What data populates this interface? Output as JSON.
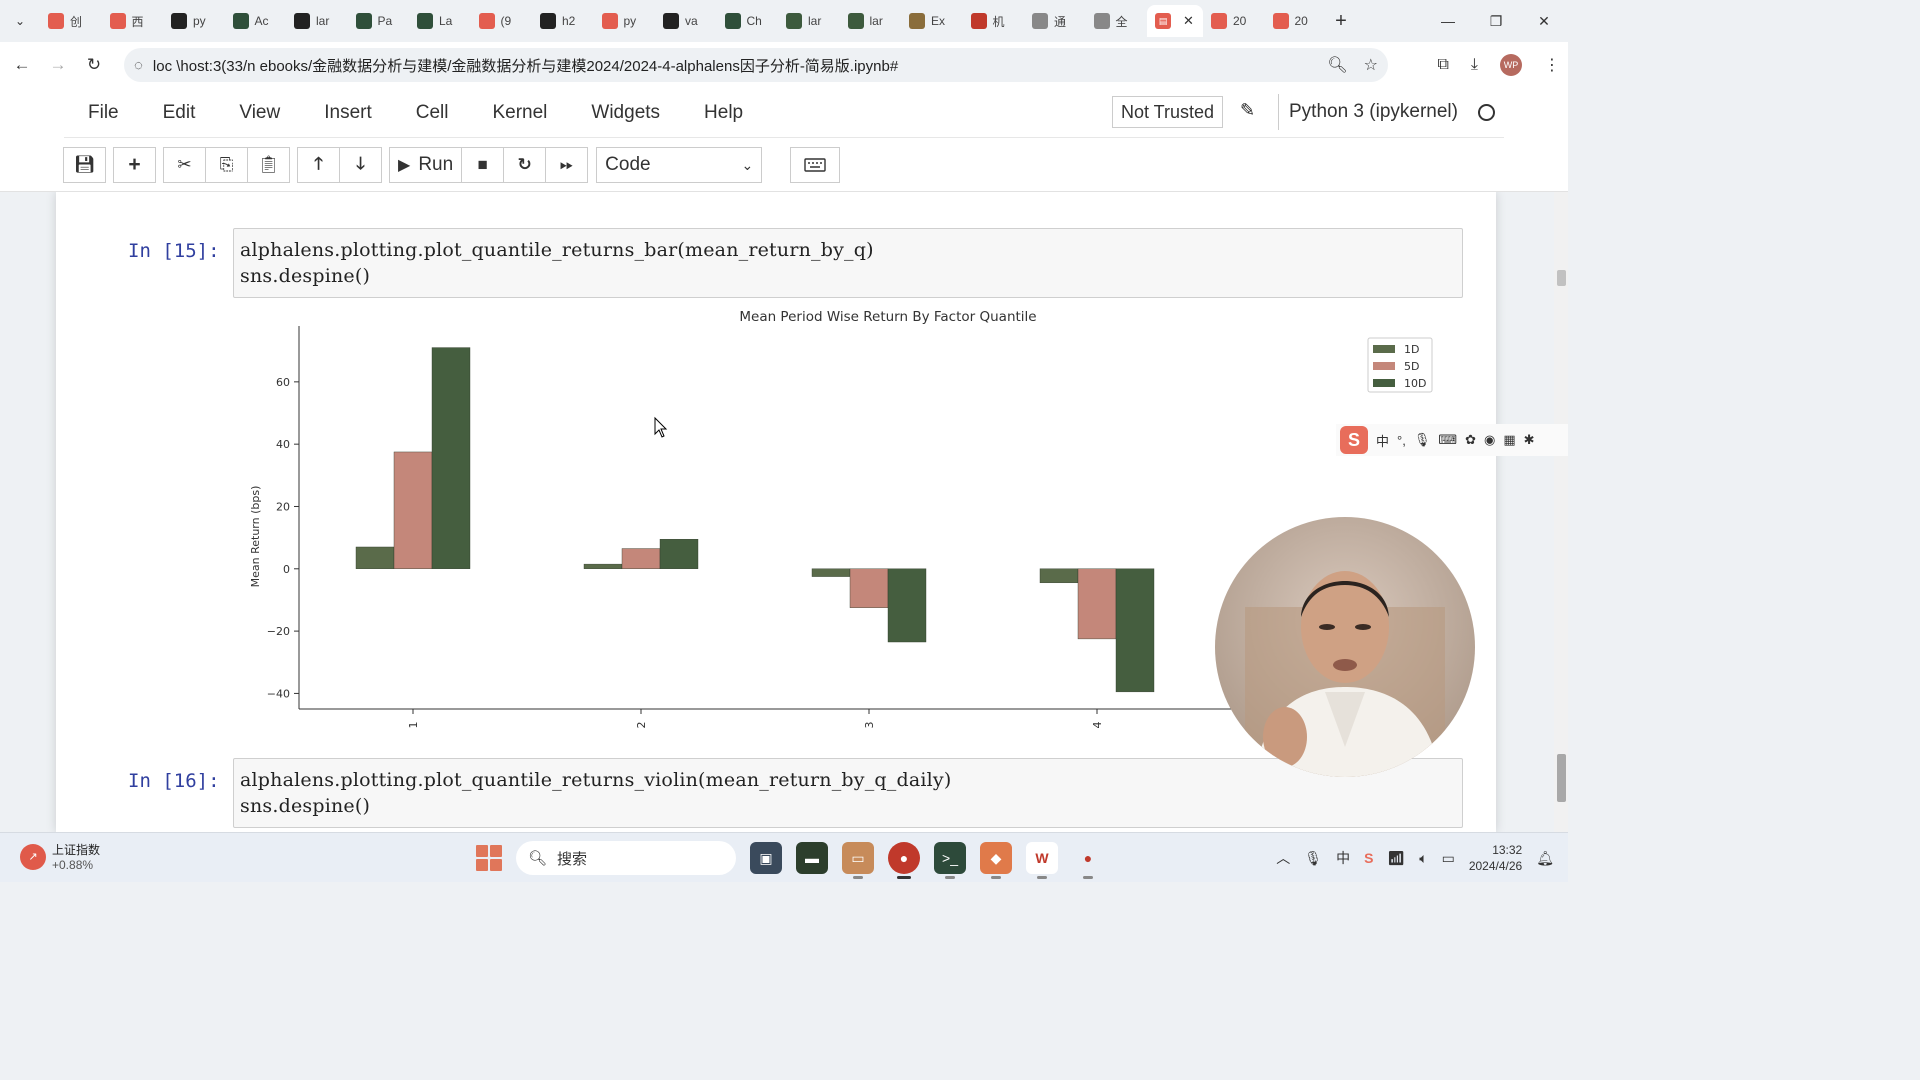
{
  "browser": {
    "tabs": [
      {
        "label": "创",
        "color": "#e35d4f"
      },
      {
        "label": "西",
        "color": "#e35d4f"
      },
      {
        "label": "py",
        "color": "#222222"
      },
      {
        "label": "Ac",
        "color": "#2f4f3a"
      },
      {
        "label": "lar",
        "color": "#222222"
      },
      {
        "label": "Pa",
        "color": "#2f4f3a"
      },
      {
        "label": "La",
        "color": "#2f4f3a"
      },
      {
        "label": "(9",
        "color": "#e35d4f"
      },
      {
        "label": "h2",
        "color": "#222222"
      },
      {
        "label": "py",
        "color": "#e35d4f"
      },
      {
        "label": "va",
        "color": "#222222"
      },
      {
        "label": "Ch",
        "color": "#2f4f3a"
      },
      {
        "label": "lar",
        "color": "#3d5a3d"
      },
      {
        "label": "lar",
        "color": "#3d5a3d"
      },
      {
        "label": "Ex",
        "color": "#8a6d3b"
      },
      {
        "label": "机",
        "color": "#c0392b"
      },
      {
        "label": "通",
        "color": "#888888"
      },
      {
        "label": "全",
        "color": "#888888"
      }
    ],
    "active_tab_icon": "notebook-icon",
    "other_tabs": [
      {
        "label": "20",
        "color": "#e35d4f"
      },
      {
        "label": "20",
        "color": "#e35d4f"
      }
    ],
    "url": "loc \\host:3(33/n ebooks/金融数据分析与建模/金融数据分析与建模2024/2024-4-alphalens因子分析-简易版.ipynb#",
    "avatar_text": "WP"
  },
  "jupyter": {
    "menu": [
      "File",
      "Edit",
      "View",
      "Insert",
      "Cell",
      "Kernel",
      "Widgets",
      "Help"
    ],
    "trusted_label": "Not Trusted",
    "kernel_label": "Python 3 (ipykernel)",
    "run_label": "Run",
    "cell_type": "Code"
  },
  "cells": [
    {
      "prompt": "In  [15]:",
      "lines": [
        "alphalens.plotting.plot_quantile_returns_bar(mean_return_by_q)",
        "sns.despine()"
      ]
    },
    {
      "prompt": "In  [16]:",
      "lines": [
        "alphalens.plotting.plot_quantile_returns_violin(mean_return_by_q_daily)",
        "sns.despine()"
      ]
    }
  ],
  "chart_data": {
    "type": "bar",
    "title": "Mean Period Wise Return By Factor Quantile",
    "xlabel": "",
    "ylabel": "Mean Return (bps)",
    "categories": [
      "1",
      "2",
      "3",
      "4"
    ],
    "series": [
      {
        "name": "1D",
        "color": "#5a6b4a",
        "values": [
          7,
          1.5,
          -2.5,
          -4.5
        ]
      },
      {
        "name": "5D",
        "color": "#c4877a",
        "values": [
          37.5,
          6.5,
          -12.5,
          -22.5
        ]
      },
      {
        "name": "10D",
        "color": "#455e3f",
        "values": [
          71,
          9.5,
          -23.5,
          -39.5
        ]
      }
    ],
    "yticks": [
      -40,
      -20,
      0,
      20,
      40,
      60
    ],
    "ylim": [
      -45,
      76
    ],
    "legend_position": "top-right",
    "grid": false
  },
  "ime": {
    "label": "中",
    "punct": "°,"
  },
  "taskbar": {
    "stock_name": "上证指数",
    "stock_change": "+0.88%",
    "search_placeholder": "搜索",
    "time": "13:32",
    "date": "2024/4/26"
  }
}
